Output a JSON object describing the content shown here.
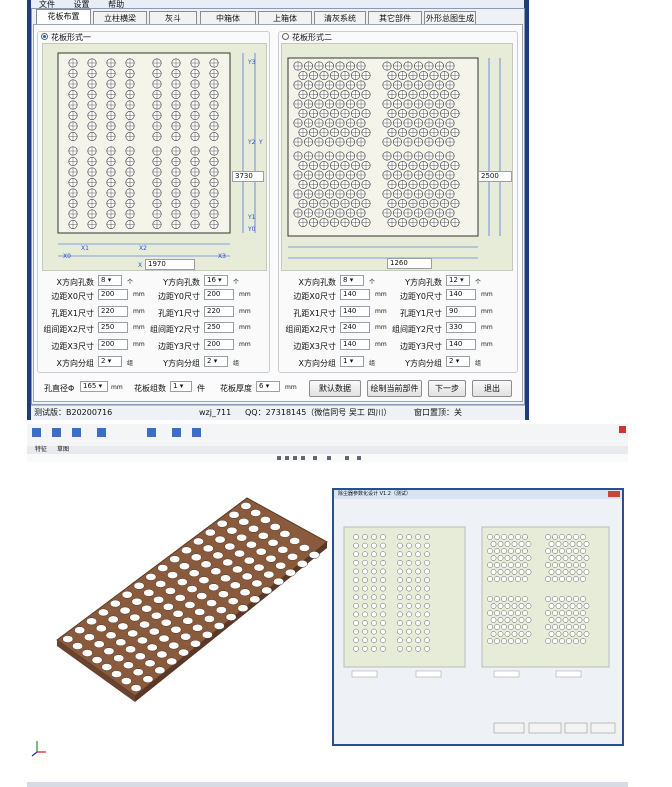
{
  "menu": [
    "文件",
    "设置",
    "帮助"
  ],
  "tabs": [
    "花板布置",
    "立柱横梁",
    "灰斗",
    "中箱体",
    "上箱体",
    "清灰系统",
    "其它部件",
    "外形总图生成"
  ],
  "active_tab": 0,
  "form1": {
    "title": "花板形式一",
    "selected": true,
    "side_value": "3730",
    "bottom_value": "1970",
    "dims": {
      "x1": "X1",
      "x2": "X2",
      "x0": "X0",
      "x3": "X3",
      "y0": "Y0",
      "y1": "Y1",
      "y2": "Y2",
      "y3": "Y3",
      "x": "X",
      "y": "Y"
    },
    "left_fields": [
      {
        "label": "X方向孔数",
        "value": "8",
        "unit": "个",
        "dropdown": true
      },
      {
        "label": "边距X0尺寸",
        "value": "200",
        "unit": "mm"
      },
      {
        "label": "孔距X1尺寸",
        "value": "220",
        "unit": "mm"
      },
      {
        "label": "组间距X2尺寸",
        "value": "250",
        "unit": "mm"
      },
      {
        "label": "边距X3尺寸",
        "value": "200",
        "unit": "mm"
      },
      {
        "label": "X方向分组",
        "value": "2",
        "unit": "组",
        "dropdown": true
      }
    ],
    "right_fields": [
      {
        "label": "Y方向孔数",
        "value": "16",
        "unit": "个",
        "dropdown": true
      },
      {
        "label": "边距Y0尺寸",
        "value": "200",
        "unit": "mm"
      },
      {
        "label": "孔距Y1尺寸",
        "value": "220",
        "unit": "mm"
      },
      {
        "label": "组间距Y2尺寸",
        "value": "250",
        "unit": "mm"
      },
      {
        "label": "边距Y3尺寸",
        "value": "200",
        "unit": "mm"
      },
      {
        "label": "Y方向分组",
        "value": "2",
        "unit": "组",
        "dropdown": true
      }
    ]
  },
  "form2": {
    "title": "花板形式二",
    "selected": false,
    "side_value": "2500",
    "bottom_value": "1260",
    "left_fields": [
      {
        "label": "X方向孔数",
        "value": "8",
        "unit": "个",
        "dropdown": true
      },
      {
        "label": "边距X0尺寸",
        "value": "140",
        "unit": "mm"
      },
      {
        "label": "孔距X1尺寸",
        "value": "140",
        "unit": "mm"
      },
      {
        "label": "组间距X2尺寸",
        "value": "240",
        "unit": "mm"
      },
      {
        "label": "边距X3尺寸",
        "value": "140",
        "unit": "mm"
      },
      {
        "label": "X方向分组",
        "value": "1",
        "unit": "组",
        "dropdown": true
      }
    ],
    "right_fields": [
      {
        "label": "Y方向孔数",
        "value": "12",
        "unit": "个",
        "dropdown": true
      },
      {
        "label": "边距Y0尺寸",
        "value": "140",
        "unit": "mm"
      },
      {
        "label": "孔距Y1尺寸",
        "value": "90",
        "unit": "mm"
      },
      {
        "label": "组间距Y2尺寸",
        "value": "330",
        "unit": "mm"
      },
      {
        "label": "边距Y3尺寸",
        "value": "140",
        "unit": "mm"
      },
      {
        "label": "Y方向分组",
        "value": "2",
        "unit": "组",
        "dropdown": true
      }
    ]
  },
  "bottom": {
    "hole_dia_label": "孔直径Φ",
    "hole_dia_value": "165",
    "hole_dia_unit": "mm",
    "plate_groups_label": "花板组数",
    "plate_groups_value": "1",
    "plate_groups_unit": "件",
    "thickness_label": "花板厚度",
    "thickness_value": "6",
    "thickness_unit": "mm",
    "buttons": [
      "默认数据",
      "绘制当前部件",
      "下一步",
      "退出"
    ]
  },
  "status": {
    "version": "测试版：B20200716",
    "user": "wzj_711",
    "qq": "QQ：27318145（微信同号 吴工 四川）",
    "topmost": "窗口置顶：关"
  },
  "cad": {
    "embedded_title": "除尘器参数化设计 V1.2（测试）",
    "feature_tabs": [
      "特征",
      "草图"
    ]
  },
  "colors": {
    "titlebar": "#1f3f74",
    "plate": "#8a5a3c",
    "drawing_bg": "#e7ecd9",
    "dim_blue": "#2b4fd1"
  }
}
